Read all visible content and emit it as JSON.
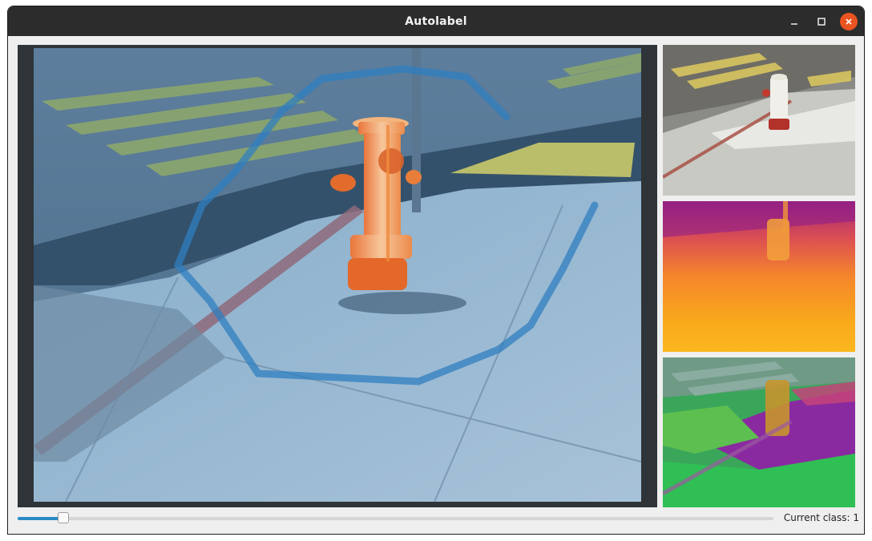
{
  "window": {
    "title": "Autolabel",
    "controls": {
      "minimize_icon": "minimize-icon",
      "maximize_icon": "maximize-icon",
      "close_icon": "close-icon",
      "close_color": "#e95420"
    }
  },
  "main_view": {
    "description_icon": "segmentation-overlay",
    "mask_color": "#f07a2a",
    "stroke_color": "#2f7fc0"
  },
  "side_panels": [
    {
      "kind": "rgb-thumbnail"
    },
    {
      "kind": "depth-map",
      "palette": [
        "#8b1c8c",
        "#e9533a",
        "#f9a51f",
        "#fbb51e"
      ]
    },
    {
      "kind": "feature-map"
    }
  ],
  "footer": {
    "slider_value_fraction": 0.06,
    "slider_accent": "#2b8ac4",
    "current_class_label": "Current class: 1"
  }
}
